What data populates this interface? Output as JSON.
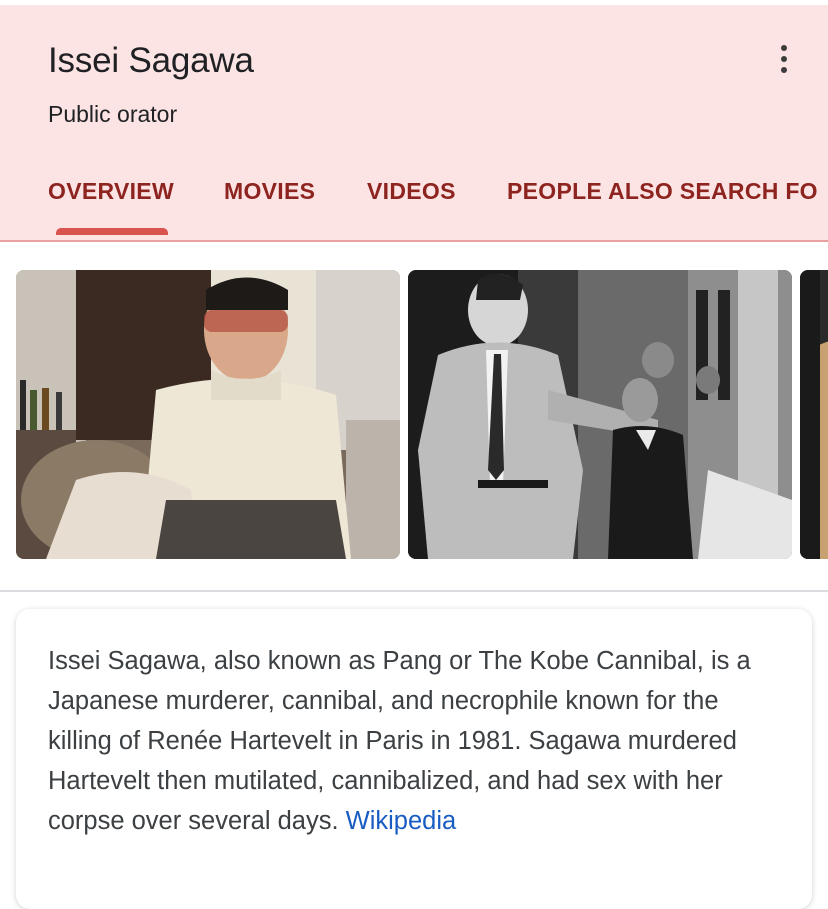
{
  "header": {
    "title": "Issei Sagawa",
    "subtitle": "Public orator",
    "more_icon": "more-vert-icon"
  },
  "tabs": [
    {
      "label": "OVERVIEW",
      "selected": true
    },
    {
      "label": "MOVIES",
      "selected": false
    },
    {
      "label": "VIDEOS",
      "selected": false
    },
    {
      "label": "PEOPLE ALSO SEARCH FO",
      "selected": false
    }
  ],
  "colors": {
    "header_bg": "#fde4e4",
    "tab_text": "#8e2420",
    "tab_indicator": "#d9534f",
    "link": "#1a5dc2"
  },
  "description": {
    "text": "Issei Sagawa, also known as Pang or The Kobe Cannibal, is a Japanese murderer, cannibal, and necrophile known for the killing of Renée Hartevelt in Paris in 1981. Sagawa murdered Hartevelt then mutilated, cannibalized, and had sex with her corpse over several days.",
    "source_link": "Wikipedia"
  }
}
